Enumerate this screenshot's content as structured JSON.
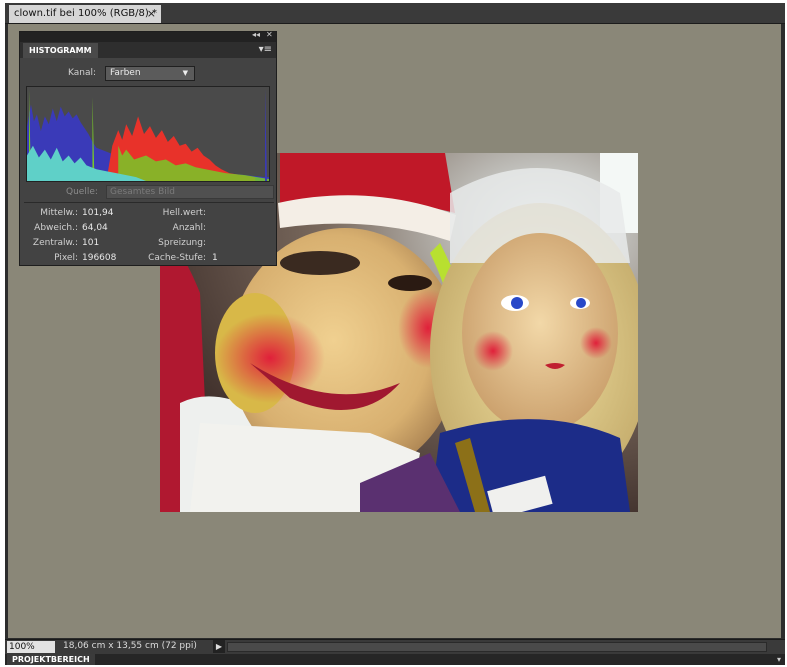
{
  "document": {
    "tab_title": "clown.tif bei 100% (RGB/8) *",
    "tab_close": "×"
  },
  "histogram_panel": {
    "title": "HISTOGRAMM",
    "collapse_icon": "◂◂",
    "close_icon": "✕",
    "menu_icon": "▾≡",
    "channel_label": "Kanal:",
    "channel_value": "Farben",
    "source_label": "Quelle:",
    "source_value": "Gesamtes Bild",
    "stats": {
      "mean_label": "Mittelw.:",
      "mean_value": "101,94",
      "deviation_label": "Abweich.:",
      "deviation_value": "64,04",
      "median_label": "Zentralw.:",
      "median_value": "101",
      "pixels_label": "Pixel:",
      "pixels_value": "196608",
      "level_label": "Hell.wert:",
      "level_value": "",
      "count_label": "Anzahl:",
      "count_value": "",
      "percentile_label": "Spreizung:",
      "percentile_value": "",
      "cache_label": "Cache-Stufe:",
      "cache_value": "1"
    }
  },
  "status_bar": {
    "zoom": "100%",
    "doc_info": "18,06 cm x 13,55 cm (72 ppi)",
    "arrow_icon": "▶"
  },
  "project_bar": {
    "label": "PROJEKTBEREICH",
    "arrow_icon": "▾"
  },
  "colors": {
    "canvas_bg": "#8a8778",
    "panel_bg": "#434343",
    "histogram_blue": "#3a3ab8",
    "histogram_red": "#e8322a",
    "histogram_green": "#78c828",
    "histogram_cyan": "#5fd0c8"
  }
}
